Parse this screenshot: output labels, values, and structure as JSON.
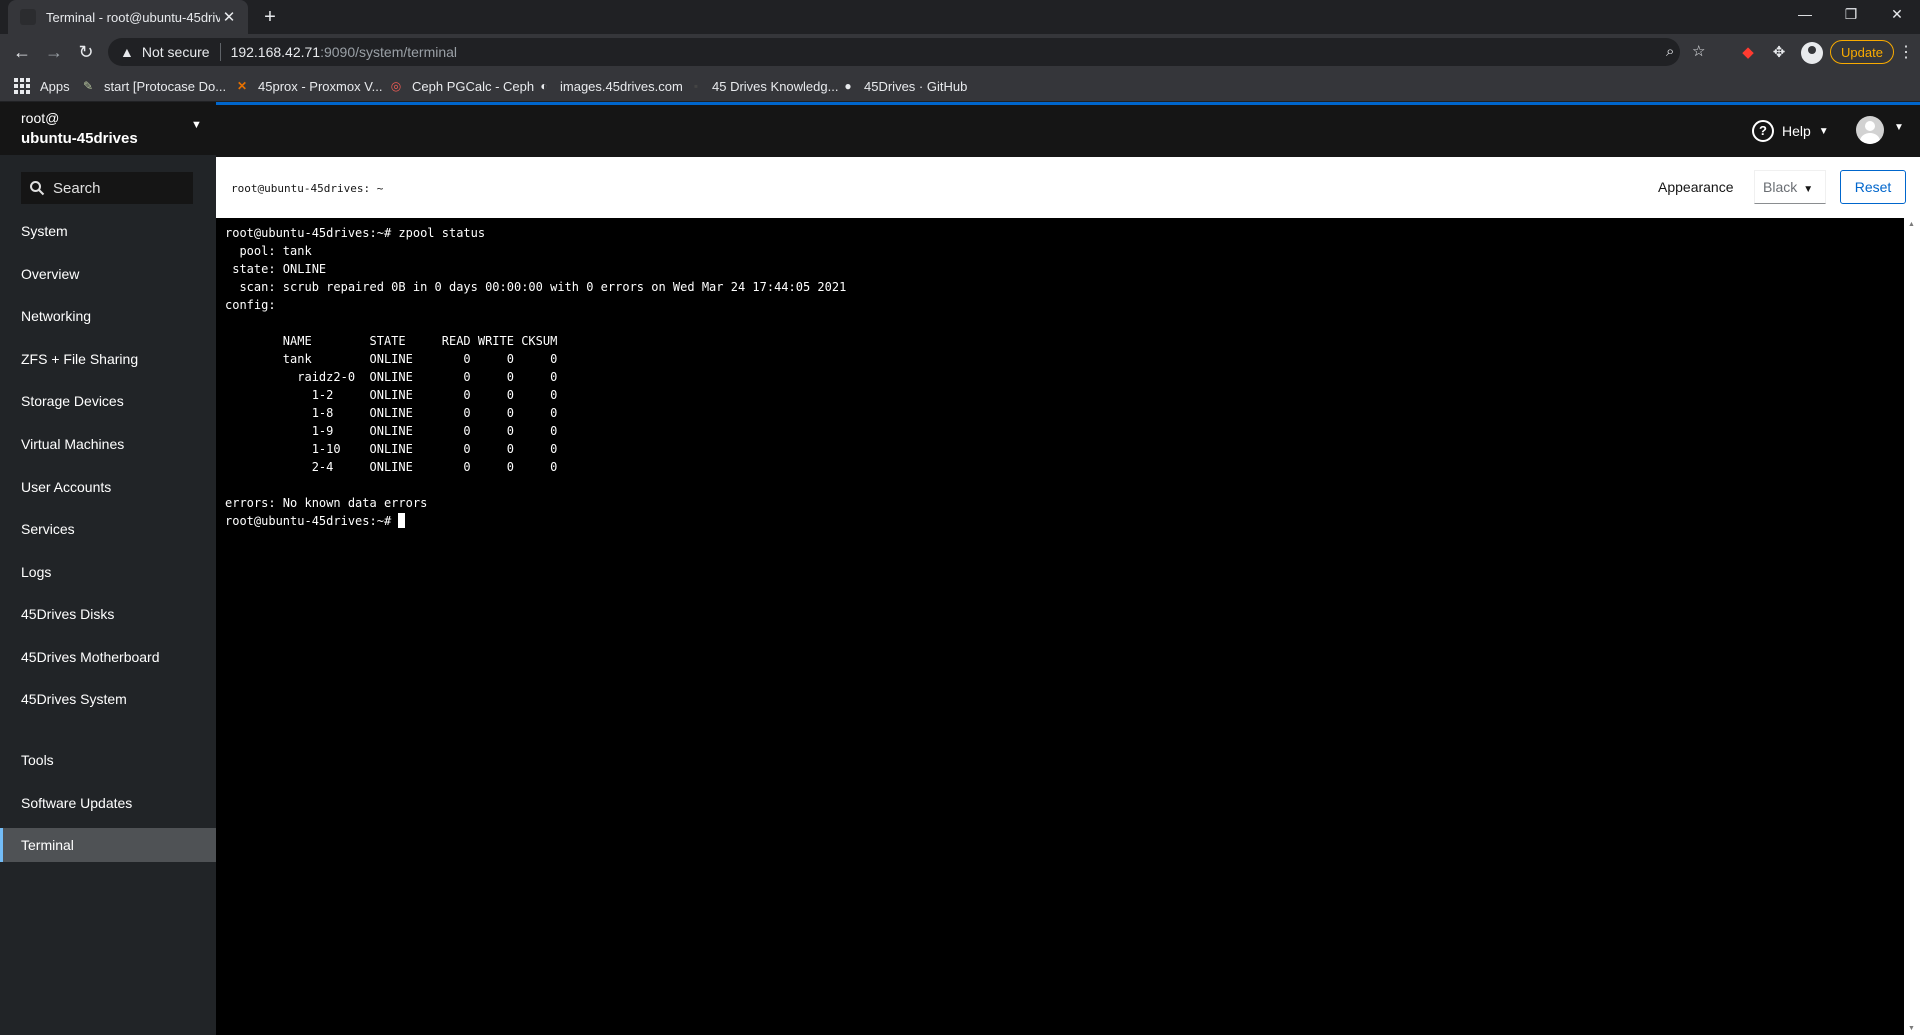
{
  "browser": {
    "tab_title": "Terminal - root@ubuntu-45drives",
    "new_tab": "+",
    "window_controls": {
      "minimize": "—",
      "restore": "❐",
      "close": "✕"
    },
    "security_label": "Not secure",
    "url_host": "192.168.42.71",
    "url_path": ":9090/system/terminal",
    "update_label": "Update",
    "bookmarks": [
      {
        "label": "Apps",
        "icon": "apps-grid-icon"
      },
      {
        "label": "start [Protocase Do...",
        "icon": "protocase-icon"
      },
      {
        "label": "45prox - Proxmox V...",
        "icon": "proxmox-icon"
      },
      {
        "label": "Ceph PGCalc - Ceph",
        "icon": "ceph-icon"
      },
      {
        "label": "images.45drives.com",
        "icon": "globe-icon"
      },
      {
        "label": "45 Drives Knowledg...",
        "icon": "45drives-icon"
      },
      {
        "label": "45Drives · GitHub",
        "icon": "github-icon"
      }
    ]
  },
  "cockpit": {
    "host": {
      "user": "root@",
      "hostname": "ubuntu-45drives"
    },
    "search_placeholder": "Search",
    "nav": [
      {
        "label": "System",
        "active": false
      },
      {
        "label": "Overview",
        "active": false
      },
      {
        "label": "Networking",
        "active": false
      },
      {
        "label": "ZFS + File Sharing",
        "active": false
      },
      {
        "label": "Storage Devices",
        "active": false
      },
      {
        "label": "Virtual Machines",
        "active": false
      },
      {
        "label": "User Accounts",
        "active": false
      },
      {
        "label": "Services",
        "active": false
      },
      {
        "label": "Logs",
        "active": false
      },
      {
        "label": "45Drives Disks",
        "active": false
      },
      {
        "label": "45Drives Motherboard",
        "active": false
      },
      {
        "label": "45Drives System",
        "active": false
      },
      {
        "label": "Tools",
        "active": false
      },
      {
        "label": "Software Updates",
        "active": false
      },
      {
        "label": "Terminal",
        "active": true
      }
    ],
    "help_label": "Help",
    "terminal": {
      "title": "root@ubuntu-45drives: ~",
      "appearance_label": "Appearance",
      "theme_value": "Black",
      "reset_label": "Reset",
      "output": "root@ubuntu-45drives:~# zpool status\n  pool: tank\n state: ONLINE\n  scan: scrub repaired 0B in 0 days 00:00:00 with 0 errors on Wed Mar 24 17:44:05 2021\nconfig:\n\n        NAME        STATE     READ WRITE CKSUM\n        tank        ONLINE       0     0     0\n          raidz2-0  ONLINE       0     0     0\n            1-2     ONLINE       0     0     0\n            1-8     ONLINE       0     0     0\n            1-9     ONLINE       0     0     0\n            1-10    ONLINE       0     0     0\n            2-4     ONLINE       0     0     0\n\nerrors: No known data errors",
      "prompt": "root@ubuntu-45drives:~# "
    }
  }
}
